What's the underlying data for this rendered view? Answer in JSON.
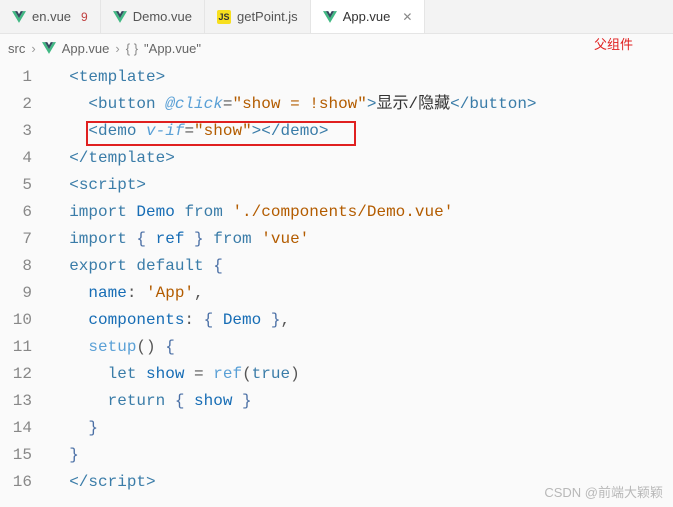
{
  "tabs": [
    {
      "icon": "vue",
      "label": "en.vue",
      "badge": "9",
      "active": false,
      "closable": false
    },
    {
      "icon": "vue",
      "label": "Demo.vue",
      "badge": "",
      "active": false,
      "closable": false
    },
    {
      "icon": "js",
      "label": "getPoint.js",
      "badge": "",
      "active": false,
      "closable": false
    },
    {
      "icon": "vue",
      "label": "App.vue",
      "badge": "",
      "active": true,
      "closable": true
    }
  ],
  "annotation": "父组件",
  "breadcrumb": {
    "root": "src",
    "file": "App.vue",
    "symbol": "\"App.vue\""
  },
  "code": {
    "l1": {
      "open": "<",
      "tag": "template",
      "close": ">"
    },
    "l2": {
      "open": "<",
      "tag": "button",
      "attr": "@click",
      "eq": "=",
      "q1": "\"",
      "val": "show = !show",
      "q2": "\"",
      "gt": ">",
      "text": "显示/隐藏",
      "copen": "</",
      "ctag": "button",
      "cgt": ">"
    },
    "l3": {
      "open": "<",
      "tag": "demo",
      "attr": "v-if",
      "eq": "=",
      "q1": "\"",
      "val": "show",
      "q2": "\"",
      "gt": ">",
      "copen": "</",
      "ctag": "demo",
      "cgt": ">"
    },
    "l4": {
      "open": "</",
      "tag": "template",
      "close": ">"
    },
    "l5": {
      "open": "<",
      "tag": "script",
      "close": ">"
    },
    "l6": {
      "kw1": "import",
      "id": "Demo",
      "kw2": "from",
      "str": "'./components/Demo.vue'"
    },
    "l7": {
      "kw1": "import",
      "lb": "{ ",
      "id": "ref",
      "rb": " }",
      "kw2": "from",
      "str": "'vue'"
    },
    "l8": {
      "kw1": "export",
      "kw2": "default",
      "lb": "{"
    },
    "l9": {
      "key": "name",
      "colon": ": ",
      "str": "'App'",
      "comma": ","
    },
    "l10": {
      "key": "components",
      "colon": ": ",
      "lb": "{ ",
      "id": "Demo",
      "rb": " }",
      "comma": ","
    },
    "l11": {
      "fn": "setup",
      "paren": "()",
      "lb": " {"
    },
    "l12": {
      "kw": "let",
      "id": "show",
      "eq": " = ",
      "fn": "ref",
      "lp": "(",
      "arg": "true",
      "rp": ")"
    },
    "l13": {
      "kw": "return",
      "lb": " { ",
      "id": "show",
      "rb": " }"
    },
    "l14": {
      "rb": "}"
    },
    "l15": {
      "rb": "}"
    },
    "l16": {
      "open": "</",
      "tag": "script",
      "close": ">"
    }
  },
  "lineNumbers": [
    "1",
    "2",
    "3",
    "4",
    "5",
    "6",
    "7",
    "8",
    "9",
    "10",
    "11",
    "12",
    "13",
    "14",
    "15",
    "16"
  ],
  "watermark": "CSDN @前端大颖颖",
  "icons": {
    "js_label": "JS",
    "close_glyph": "✕",
    "chevron": "›"
  }
}
